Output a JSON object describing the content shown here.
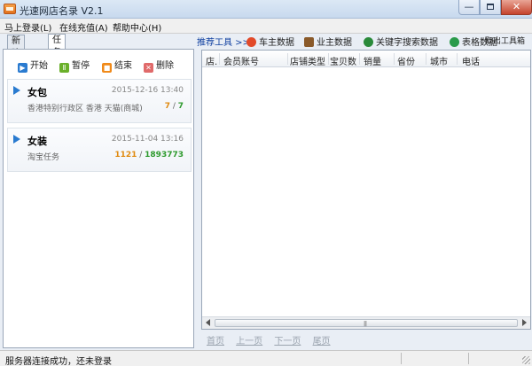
{
  "window": {
    "title": "光速网店名录 V2.1",
    "min_glyph": "—",
    "close_glyph": "✕"
  },
  "menu": [
    "马上登录(L)",
    "在线充值(A)",
    "帮助中心(H)"
  ],
  "tabs": [
    "新建任务",
    "任务列表"
  ],
  "toolbar": {
    "recommend": "推荐工具 >>",
    "items": [
      {
        "label": "车主数据",
        "color": "#e24a2a"
      },
      {
        "label": "业主数据",
        "color": "#8a5a2a"
      },
      {
        "label": "关键字搜索数据",
        "color": "#2a8a3a"
      },
      {
        "label": "表格数据",
        "color": "#2a9a4a"
      }
    ],
    "overlap_label": "取出工具箱"
  },
  "actions": [
    {
      "label": "开始",
      "color": "#2a7bd0",
      "icon": "▶"
    },
    {
      "label": "暂停",
      "color": "#6ab02a",
      "icon": "Ⅱ"
    },
    {
      "label": "结束",
      "color": "#f08a1a",
      "icon": "■"
    },
    {
      "label": "删除",
      "color": "#e06a6a",
      "icon": "✕"
    }
  ],
  "tasks": [
    {
      "name": "女包",
      "date": "2015-12-16 13:40",
      "sub": "香港特别行政区 香港 天猫(商城)",
      "done": "7",
      "total": "7"
    },
    {
      "name": "女装",
      "date": "2015-11-04 13:16",
      "sub": "淘宝任务",
      "done": "1121",
      "total": "1893773"
    }
  ],
  "grid": {
    "columns": [
      "店.",
      "会员账号",
      "店铺类型",
      "宝贝数",
      "销量",
      "省份",
      "城市",
      "电话"
    ]
  },
  "pager": [
    "首页",
    "上一页",
    "下一页",
    "尾页"
  ],
  "status": {
    "text": "服务器连接成功，还未登录"
  }
}
